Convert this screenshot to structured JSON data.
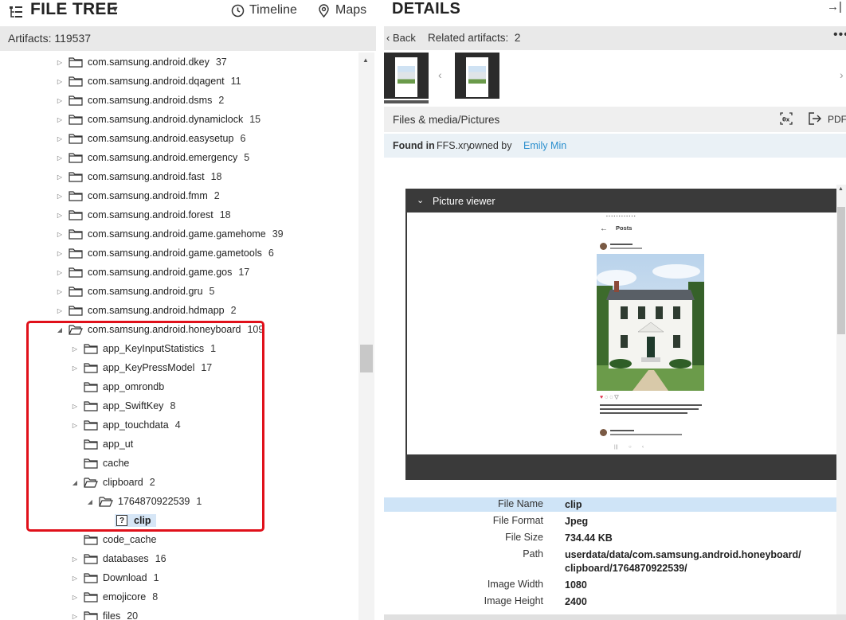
{
  "file_tree": {
    "title": "FILE TREE",
    "timeline_label": "Timeline",
    "maps_label": "Maps",
    "artifacts_label": "Artifacts: 119537"
  },
  "tree_rows": [
    {
      "name": "com.samsung.android.dkey",
      "count": "37",
      "arrow": "▷"
    },
    {
      "name": "com.samsung.android.dqagent",
      "count": "11",
      "arrow": "▷"
    },
    {
      "name": "com.samsung.android.dsms",
      "count": "2",
      "arrow": "▷"
    },
    {
      "name": "com.samsung.android.dynamiclock",
      "count": "15",
      "arrow": "▷"
    },
    {
      "name": "com.samsung.android.easysetup",
      "count": "6",
      "arrow": "▷"
    },
    {
      "name": "com.samsung.android.emergency",
      "count": "5",
      "arrow": "▷"
    },
    {
      "name": "com.samsung.android.fast",
      "count": "18",
      "arrow": "▷"
    },
    {
      "name": "com.samsung.android.fmm",
      "count": "2",
      "arrow": "▷"
    },
    {
      "name": "com.samsung.android.forest",
      "count": "18",
      "arrow": "▷"
    },
    {
      "name": "com.samsung.android.game.gamehome",
      "count": "39",
      "arrow": "▷"
    },
    {
      "name": "com.samsung.android.game.gametools",
      "count": "6",
      "arrow": "▷"
    },
    {
      "name": "com.samsung.android.game.gos",
      "count": "17",
      "arrow": "▷"
    },
    {
      "name": "com.samsung.android.gru",
      "count": "5",
      "arrow": "▷"
    },
    {
      "name": "com.samsung.android.hdmapp",
      "count": "2",
      "arrow": "▷"
    },
    {
      "name": "com.samsung.android.honeyboard",
      "count": "109",
      "arrow": "◢"
    },
    {
      "name": "app_KeyInputStatistics",
      "count": "1",
      "arrow": "▷"
    },
    {
      "name": "app_KeyPressModel",
      "count": "17",
      "arrow": "▷"
    },
    {
      "name": "app_omrondb",
      "count": "",
      "arrow": ""
    },
    {
      "name": "app_SwiftKey",
      "count": "8",
      "arrow": "▷"
    },
    {
      "name": "app_touchdata",
      "count": "4",
      "arrow": "▷"
    },
    {
      "name": "app_ut",
      "count": "",
      "arrow": ""
    },
    {
      "name": "cache",
      "count": "",
      "arrow": ""
    },
    {
      "name": "clipboard",
      "count": "2",
      "arrow": "◢"
    },
    {
      "name": "1764870922539",
      "count": "1",
      "arrow": "◢"
    },
    {
      "name": "clip",
      "count": "",
      "arrow": ""
    },
    {
      "name": "code_cache",
      "count": "",
      "arrow": ""
    },
    {
      "name": "databases",
      "count": "16",
      "arrow": "▷"
    },
    {
      "name": "Download",
      "count": "1",
      "arrow": "▷"
    },
    {
      "name": "emojicore",
      "count": "8",
      "arrow": "▷"
    },
    {
      "name": "files",
      "count": "20",
      "arrow": "▷"
    }
  ],
  "details": {
    "title": "DETAILS",
    "back_label": "Back",
    "related_label": "Related artifacts:",
    "related_count": "2",
    "category": "Files & media/Pictures",
    "pdf_label": "PDF",
    "found_in_label": "Found in",
    "found_file": "FFS.xry",
    "owned_by_label": "owned by",
    "owner": "Emily Min",
    "viewer_title": "Picture viewer",
    "phone_screen_title": "Posts"
  },
  "properties": [
    {
      "key": "File Name",
      "value": "clip"
    },
    {
      "key": "File Format",
      "value": "Jpeg"
    },
    {
      "key": "File Size",
      "value": "734.44 KB"
    },
    {
      "key": "Path",
      "value": "userdata/data/com.samsung.android.honeyboard/"
    },
    {
      "key": "",
      "value": "clipboard/1764870922539/"
    },
    {
      "key": "Image Width",
      "value": "1080"
    },
    {
      "key": "Image Height",
      "value": "2400"
    }
  ],
  "colors": {
    "highlight_border": "#e0101a",
    "selection": "#d6e6f6",
    "link": "#2b8fce",
    "row_highlight": "#cfe4f7"
  }
}
